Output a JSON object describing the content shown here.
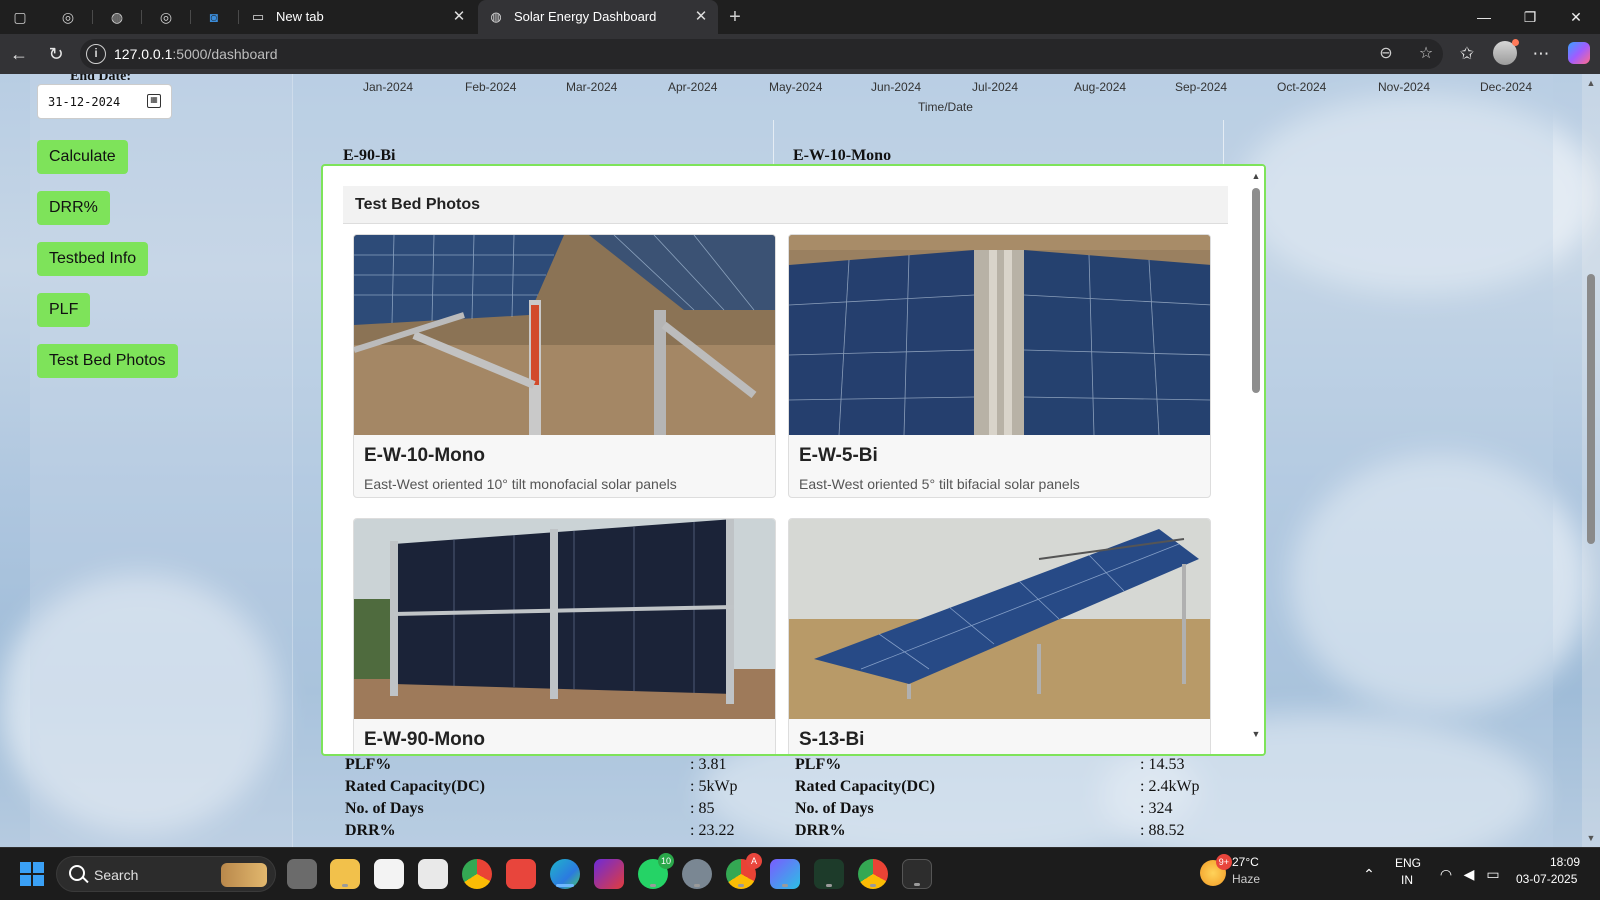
{
  "browser": {
    "tabs": [
      {
        "title": "New tab"
      },
      {
        "title": "Solar Energy Dashboard"
      }
    ],
    "url_host": "127.0.0.1",
    "url_path": ":5000/dashboard"
  },
  "sidebar": {
    "end_date_label": "End Date:",
    "end_date_value": "31-12-2024",
    "buttons": {
      "calculate": "Calculate",
      "drr": "DRR%",
      "testbed_info": "Testbed Info",
      "plf": "PLF",
      "test_bed_photos": "Test Bed Photos"
    }
  },
  "chart_axis": {
    "x_ticks": [
      "Jan-2024",
      "Feb-2024",
      "Mar-2024",
      "Apr-2024",
      "May-2024",
      "Jun-2024",
      "Jul-2024",
      "Aug-2024",
      "Sep-2024",
      "Oct-2024",
      "Nov-2024",
      "Dec-2024"
    ],
    "x_title": "Time/Date"
  },
  "cards_behind": {
    "left_title": "E-90-Bi",
    "right_title": "E-W-10-Mono"
  },
  "stats_left": {
    "plf_label": "PLF%",
    "plf_value": ": 3.81",
    "cap_label": "Rated Capacity(DC)",
    "cap_value": ": 5kWp",
    "days_label": "No. of Days",
    "days_value": ": 85",
    "drr_label": "DRR%",
    "drr_value": ": 23.22"
  },
  "stats_right": {
    "plf_label": "PLF%",
    "plf_value": ": 14.53",
    "cap_label": "Rated Capacity(DC)",
    "cap_value": ": 2.4kWp",
    "days_label": "No. of Days",
    "days_value": ": 324",
    "drr_label": "DRR%",
    "drr_value": ": 88.52"
  },
  "modal": {
    "title": "Test Bed Photos",
    "photos": [
      {
        "name": "E-W-10-Mono",
        "desc": "East-West oriented 10° tilt monofacial solar panels"
      },
      {
        "name": "E-W-5-Bi",
        "desc": "East-West oriented 5° tilt bifacial solar panels"
      },
      {
        "name": "E-W-90-Mono",
        "desc": ""
      },
      {
        "name": "S-13-Bi",
        "desc": ""
      }
    ]
  },
  "taskbar": {
    "search_label": "Search",
    "whatsapp_badge": "10",
    "chrome_badge": "A",
    "weather_badge": "9+",
    "weather_temp": "27°C",
    "weather_desc": "Haze",
    "lang_1": "ENG",
    "lang_2": "IN",
    "time": "18:09",
    "date": "03-07-2025"
  },
  "colors": {
    "accent_green": "#7ee35a",
    "tab_active": "#333336",
    "taskbar": "#1c1c1c"
  }
}
